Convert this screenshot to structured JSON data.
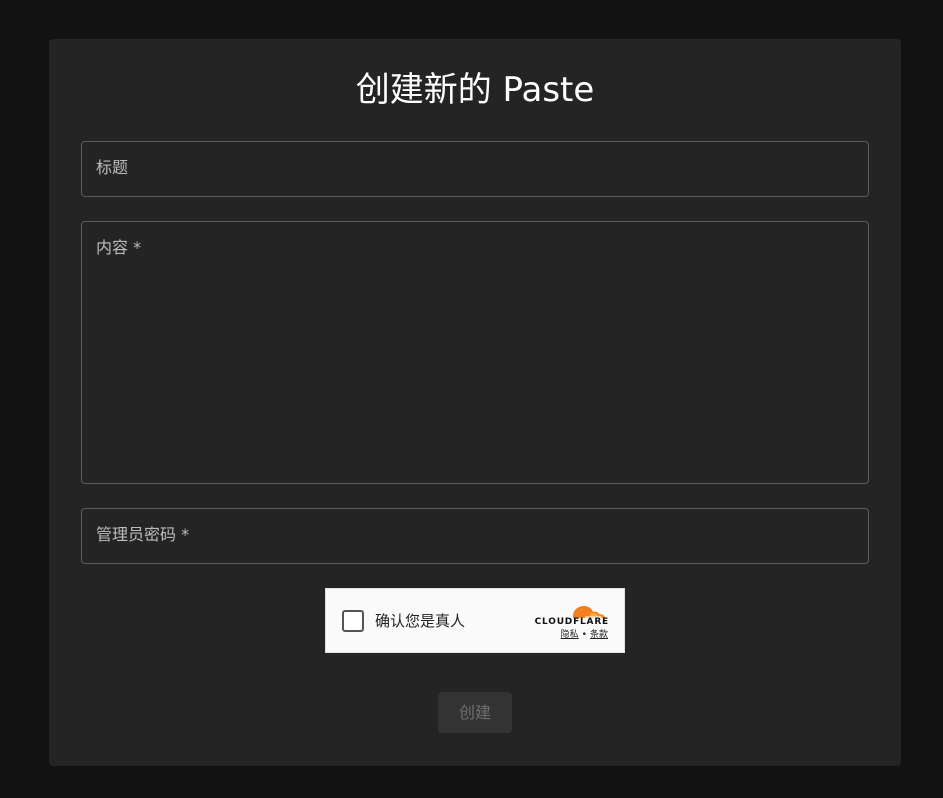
{
  "form": {
    "heading": "创建新的 Paste",
    "title_field": {
      "label": "标题"
    },
    "content_field": {
      "label": "内容 *"
    },
    "password_field": {
      "label": "管理员密码 *"
    },
    "submit_label": "创建"
  },
  "captcha": {
    "label": "确认您是真人",
    "brand": "CLOUDFLARE",
    "privacy_link": "隐私",
    "separator": "•",
    "terms_link": "条款",
    "logo_color": "#f38020",
    "checked": false
  },
  "colors": {
    "page_background": "#121212",
    "card_background": "#242424",
    "field_border": "#5c5c5c",
    "button_disabled": "#333333"
  }
}
